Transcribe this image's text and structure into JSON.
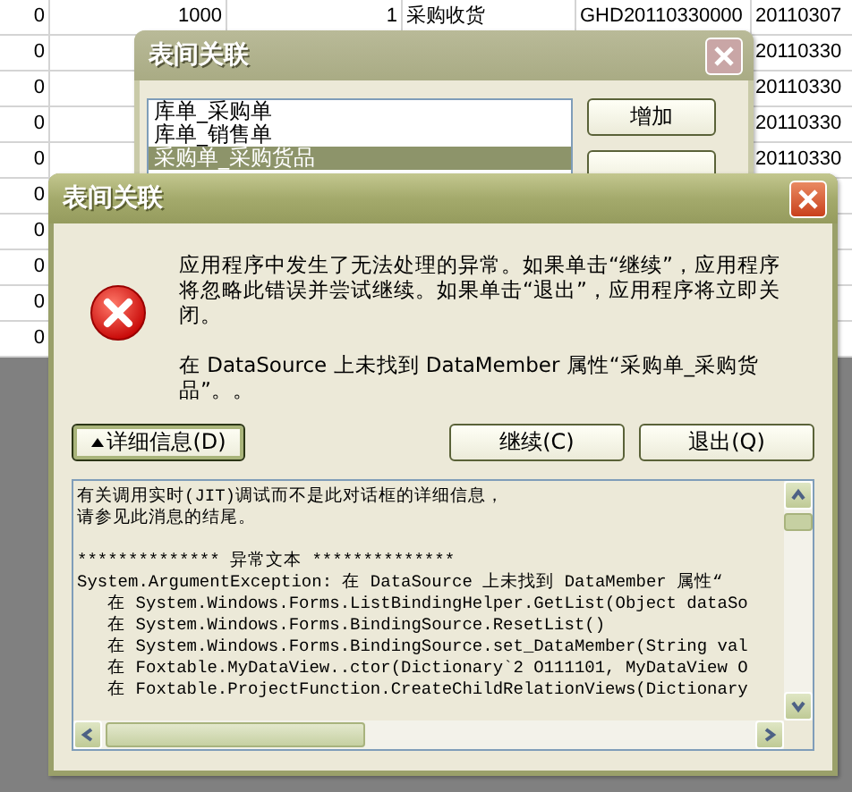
{
  "grid": {
    "rows": [
      [
        "0",
        "1000",
        "1",
        "采购收货",
        "GHD20110330000",
        "20110307"
      ],
      [
        "0",
        "",
        "",
        "",
        "",
        "20110330"
      ],
      [
        "0",
        "",
        "",
        "",
        "",
        "20110330"
      ],
      [
        "0",
        "",
        "",
        "",
        "",
        "20110330"
      ],
      [
        "0",
        "",
        "",
        "",
        "",
        "20110330"
      ],
      [
        "0"
      ],
      [
        "0"
      ],
      [
        "0"
      ],
      [
        "0"
      ],
      [
        "0"
      ]
    ]
  },
  "background_dialog": {
    "title": "表间关联",
    "list": [
      {
        "label": "库单_采购单",
        "selected": false
      },
      {
        "label": "库单_销售单",
        "selected": false
      },
      {
        "label": "采购单_采购货品",
        "selected": true
      }
    ],
    "buttons": [
      "增加"
    ]
  },
  "dialog": {
    "title": "表间关联",
    "message": [
      "应用程序中发生了无法处理的异常。如果单击“继续”，应用程序将忽略此错误并尝试继续。如果单击“退出”，应用程序将立即关闭。",
      "在 DataSource 上未找到 DataMember 属性“采购单_采购货品”。。"
    ],
    "buttons": [
      {
        "label": "详细信息(D)",
        "kind": "toggle",
        "focused": true
      },
      {
        "label": "继续(C)",
        "kind": "plain",
        "focused": false
      },
      {
        "label": "退出(Q)",
        "kind": "plain",
        "focused": false
      }
    ],
    "details": [
      [
        "有关调用实时(JIT)调试而不是此对话框的详细信息，",
        "请参见此消息的结尾。"
      ],
      [
        "************** 异常文本 **************",
        "System.ArgumentException: 在 DataSource 上未找到 DataMember 属性“",
        "   在 System.Windows.Forms.ListBindingHelper.GetList(Object dataSo",
        "   在 System.Windows.Forms.BindingSource.ResetList()",
        "   在 System.Windows.Forms.BindingSource.set_DataMember(String val",
        "   在 Foxtable.MyDataView..ctor(Dictionary`2 O111101, MyDataView O",
        "   在 Foxtable.ProjectFunction.CreateChildRelationViews(Dictionary"
      ]
    ]
  }
}
